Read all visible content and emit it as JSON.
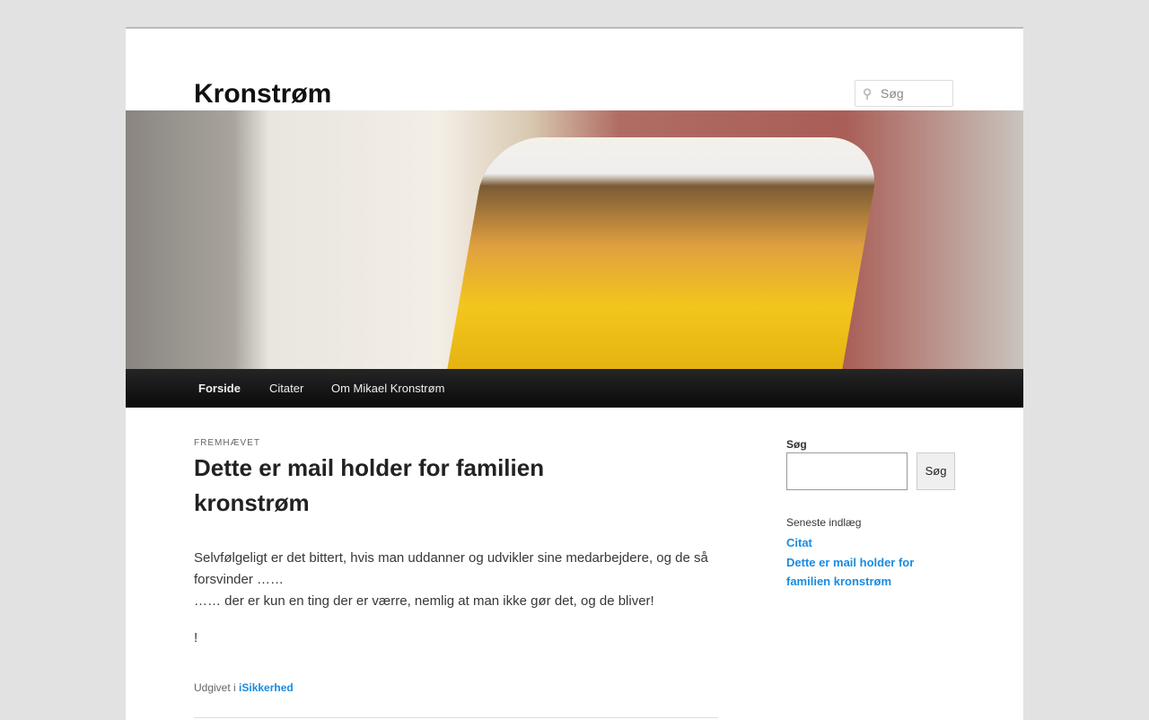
{
  "site": {
    "title": "Kronstrøm",
    "search_placeholder": "Søg"
  },
  "nav": [
    "Forside",
    "Citater",
    "Om Mikael Kronstrøm"
  ],
  "post": {
    "kicker": "FREMHÆVET",
    "title": "Dette er mail holder for familien kronstrøm",
    "paragraphs": [
      "Selvfølgeligt er det bittert, hvis man uddanner og udvikler sine medarbejdere, og de så forsvinder ……",
      "…… der er kun en ting der er værre, nemlig at man ikke gør det, og de bliver!",
      "!"
    ],
    "meta_prefix": "Udgivet i",
    "category": "iSikkerhed"
  },
  "sidebar": {
    "search_label": "Søg",
    "search_button": "Søg",
    "recent_heading": "Seneste indlæg",
    "recent": [
      "Citat",
      "Dette er mail holder for familien kronstrøm"
    ]
  }
}
